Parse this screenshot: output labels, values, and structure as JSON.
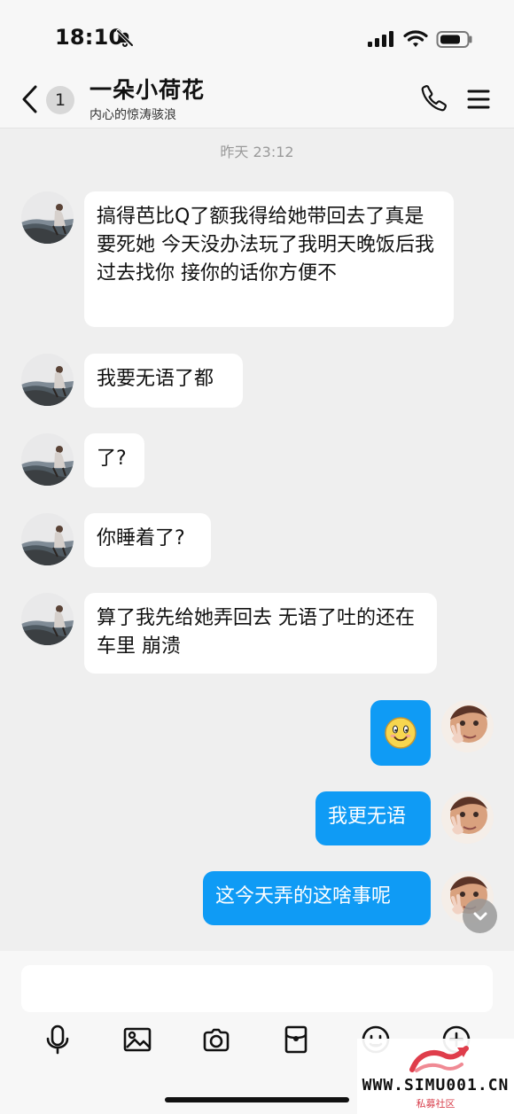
{
  "status_bar": {
    "time": "18:10",
    "icons": [
      "bell-off-icon",
      "signal-icon",
      "wifi-icon",
      "battery-icon"
    ]
  },
  "header": {
    "back_icon": "chevron-left-icon",
    "unread_count": "1",
    "title": "一朵小荷花",
    "subtitle": "内心的惊涛骇浪",
    "right_icons": [
      "phone-icon",
      "menu-icon"
    ]
  },
  "conversation": {
    "timestamp": "昨天 23:12",
    "messages": [
      {
        "direction": "incoming",
        "text": "搞得芭比Q了额我得给她带回去了真是要死她 今天没办法玩了我明天晚饭后我过去找你 接你的话你方便不"
      },
      {
        "direction": "incoming",
        "text": "我要无语了都"
      },
      {
        "direction": "incoming",
        "text": "了?"
      },
      {
        "direction": "incoming",
        "text": "你睡着了?"
      },
      {
        "direction": "incoming",
        "text": "算了我先给她弄回去  无语了吐的还在车里 崩溃"
      },
      {
        "direction": "outgoing",
        "content": "smile-emoji",
        "text": ""
      },
      {
        "direction": "outgoing",
        "text": "我更无语"
      },
      {
        "direction": "outgoing",
        "text": "这今天弄的这啥事呢"
      }
    ]
  },
  "composer": {
    "input_value": "",
    "placeholder": "",
    "toolbar_icons": [
      "microphone-icon",
      "image-icon",
      "camera-icon",
      "red-packet-icon",
      "emoji-icon",
      "plus-icon"
    ]
  },
  "colors": {
    "outgoing_bubble": "#0f9bf5",
    "incoming_bubble": "#ffffff",
    "background": "#efefef"
  },
  "watermark": {
    "domain": "WWW.SIMU001.CN",
    "subtitle": "私募社区"
  }
}
